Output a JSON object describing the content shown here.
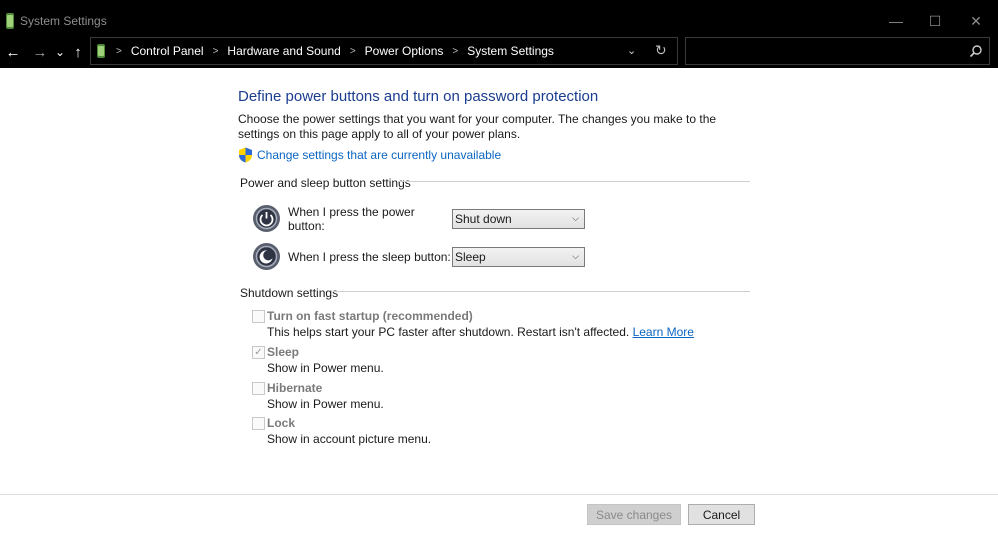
{
  "window": {
    "title": "System Settings",
    "minimize_glyph": "—",
    "maximize_glyph": "☐",
    "close_glyph": "✕"
  },
  "navigation": {
    "back_glyph": "←",
    "forward_glyph": "→",
    "recent_glyph": "⌄",
    "up_glyph": "↑",
    "breadcrumbs": [
      "Control Panel",
      "Hardware and Sound",
      "Power Options",
      "System Settings"
    ],
    "separator": ">",
    "dropdown_glyph": "⌄",
    "refresh_glyph": "↻",
    "search_placeholder": ""
  },
  "page": {
    "title": "Define power buttons and turn on password protection",
    "intro": "Choose the power settings that you want for your computer. The changes you make to the settings on this page apply to all of your power plans.",
    "change_settings_link": "Change settings that are currently unavailable"
  },
  "power_sleep": {
    "heading": "Power and sleep button settings",
    "power_label": "When I press the power button:",
    "power_value": "Shut down",
    "sleep_label": "When I press the sleep button:",
    "sleep_value": "Sleep"
  },
  "shutdown": {
    "heading": "Shutdown settings",
    "options": [
      {
        "title": "Turn on fast startup (recommended)",
        "desc": "This helps start your PC faster after shutdown. Restart isn't affected.",
        "link": "Learn More",
        "checked": false
      },
      {
        "title": "Sleep",
        "desc": "Show in Power menu.",
        "checked": true
      },
      {
        "title": "Hibernate",
        "desc": "Show in Power menu.",
        "checked": false
      },
      {
        "title": "Lock",
        "desc": "Show in account picture menu.",
        "checked": false
      }
    ]
  },
  "footer": {
    "save_label": "Save changes",
    "cancel_label": "Cancel"
  },
  "colors": {
    "title_blue": "#1a3d8f",
    "link_blue": "#0a66c2",
    "chrome_black": "#000000"
  },
  "icons": [
    "battery-icon",
    "shield-icon",
    "power-button-icon",
    "sleep-button-icon",
    "search-icon"
  ]
}
